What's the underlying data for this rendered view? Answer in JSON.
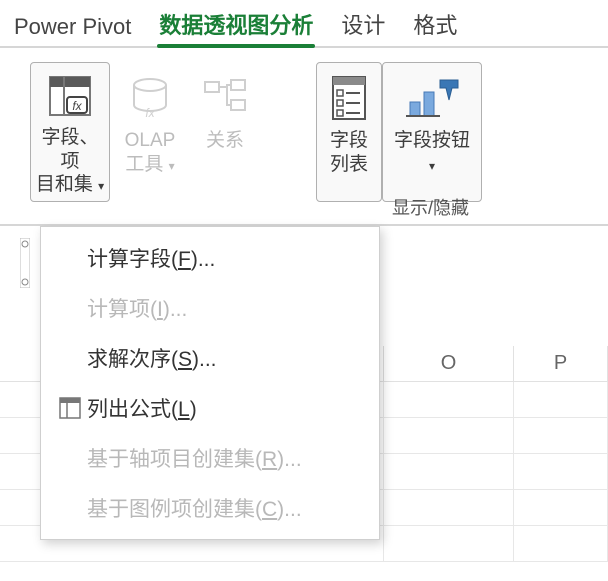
{
  "tabs": {
    "powerpivot": "Power Pivot",
    "analyze": "数据透视图分析",
    "design": "设计",
    "format": "格式"
  },
  "ribbon": {
    "fields_items_sets": {
      "line1": "字段、项",
      "line2": "目和集 "
    },
    "olap_tools": {
      "line1": "OLAP",
      "line2": "工具 "
    },
    "relations": "关系",
    "field_list": {
      "line1": "字段",
      "line2": "列表"
    },
    "field_buttons": "字段按钮",
    "group_showhide": "显示/隐藏"
  },
  "menu": {
    "calc_field": {
      "pre": "计算字段(",
      "key": "F",
      "post": ")..."
    },
    "calc_item": {
      "pre": "计算项(",
      "key": "I",
      "post": ")..."
    },
    "solve_order": {
      "pre": "求解次序(",
      "key": "S",
      "post": ")..."
    },
    "list_formulas": {
      "pre": "列出公式(",
      "key": "L",
      "post": ")"
    },
    "set_axis": {
      "pre": "基于轴项目创建集(",
      "key": "R",
      "post": ")..."
    },
    "set_legend": {
      "pre": "基于图例项创建集(",
      "key": "C",
      "post": ")..."
    }
  },
  "sheet": {
    "col_O": "O",
    "col_P": "P"
  }
}
